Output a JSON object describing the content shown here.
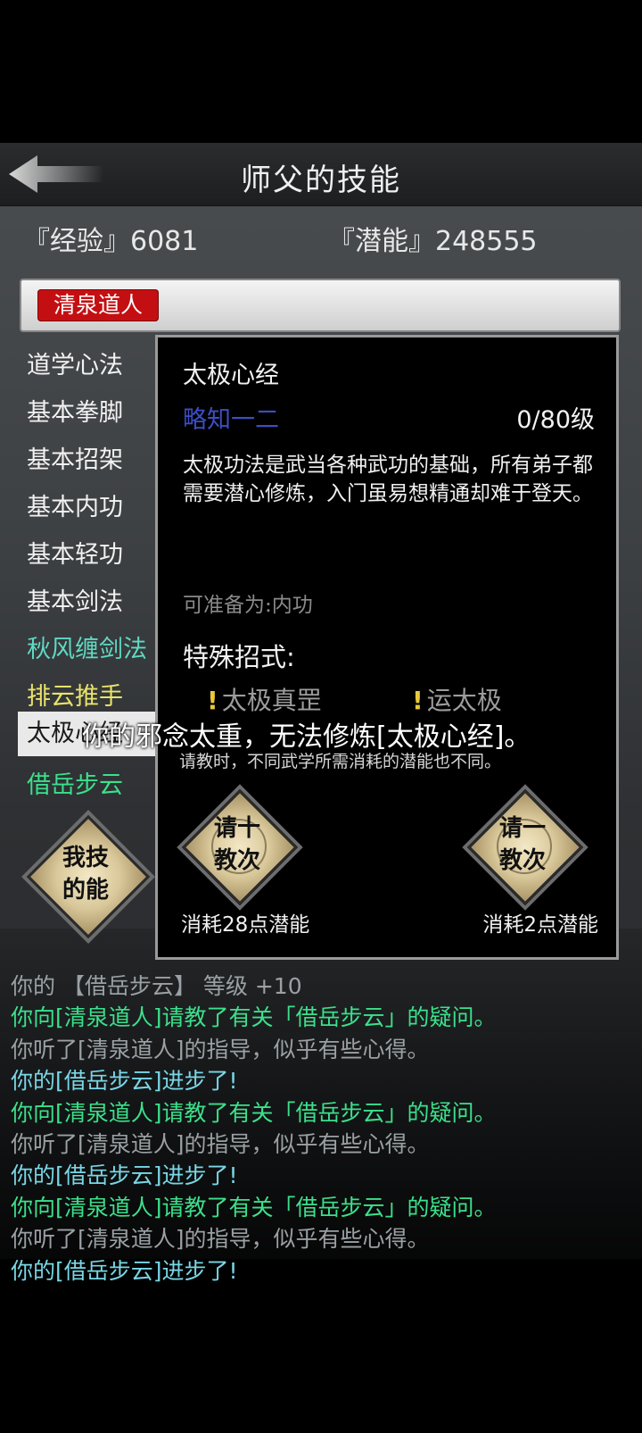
{
  "header": {
    "title": "师父的技能",
    "back_icon": "back-arrow-icon"
  },
  "stats": {
    "exp_label": "『经验』6081",
    "potential_label": "『潜能』248555"
  },
  "master": {
    "name": "清泉道人"
  },
  "skills": [
    {
      "label": "道学心法",
      "color": "#f2f2f2"
    },
    {
      "label": "基本拳脚",
      "color": "#f2f2f2"
    },
    {
      "label": "基本招架",
      "color": "#f2f2f2"
    },
    {
      "label": "基本内功",
      "color": "#f2f2f2"
    },
    {
      "label": "基本轻功",
      "color": "#f2f2f2"
    },
    {
      "label": "基本剑法",
      "color": "#f2f2f2"
    },
    {
      "label": "秋风缠剑法",
      "color": "#5fd9c2"
    },
    {
      "label": "排云推手",
      "color": "#e9e36a"
    },
    {
      "label": "太极心经",
      "color": "#1b1b1b",
      "selected": true
    },
    {
      "label": "借岳步云",
      "color": "#3be08b"
    }
  ],
  "my_skills_button": {
    "line1": "我技",
    "line2": "的能"
  },
  "popup": {
    "skill_name": "太极心经",
    "level_text": "略知一二",
    "level_max": "0/80级",
    "description": "太极功法是武当各种武功的基础，所有弟子都需要潜心修炼，入门虽易想精通却难于登天。",
    "prepare_as": "可准备为:内功",
    "special_title": "特殊招式:",
    "special_moves": [
      "太极真罡",
      "运太极"
    ],
    "hint": "请教时，不同武学所需消耗的潜能也不同。",
    "ask_ten": {
      "line1": "请十",
      "line2": "教次",
      "cost": "消耗28点潜能"
    },
    "ask_one": {
      "line1": "请一",
      "line2": "教次",
      "cost": "消耗2点潜能"
    }
  },
  "toast": "你的邪念太重，无法修炼[太极心经]。",
  "log": [
    {
      "text": "你的 【借岳步云】 等级 +10",
      "color": "gray"
    },
    {
      "text": "你向[清泉道人]请教了有关「借岳步云」的疑问。",
      "color": "green"
    },
    {
      "text": "你听了[清泉道人]的指导，似乎有些心得。",
      "color": "gray"
    },
    {
      "text": "你的[借岳步云]进步了!",
      "color": "cyan"
    },
    {
      "text": "你向[清泉道人]请教了有关「借岳步云」的疑问。",
      "color": "green"
    },
    {
      "text": "你听了[清泉道人]的指导，似乎有些心得。",
      "color": "gray"
    },
    {
      "text": "你的[借岳步云]进步了!",
      "color": "cyan"
    },
    {
      "text": "你向[清泉道人]请教了有关「借岳步云」的疑问。",
      "color": "green"
    },
    {
      "text": "你听了[清泉道人]的指导，似乎有些心得。",
      "color": "gray"
    },
    {
      "text": "你的[借岳步云]进步了!",
      "color": "cyan"
    }
  ],
  "colors": {
    "master_tag": "#c40f12",
    "level_blue": "#3d4ec4",
    "warn_yellow": "#e8c93a"
  }
}
